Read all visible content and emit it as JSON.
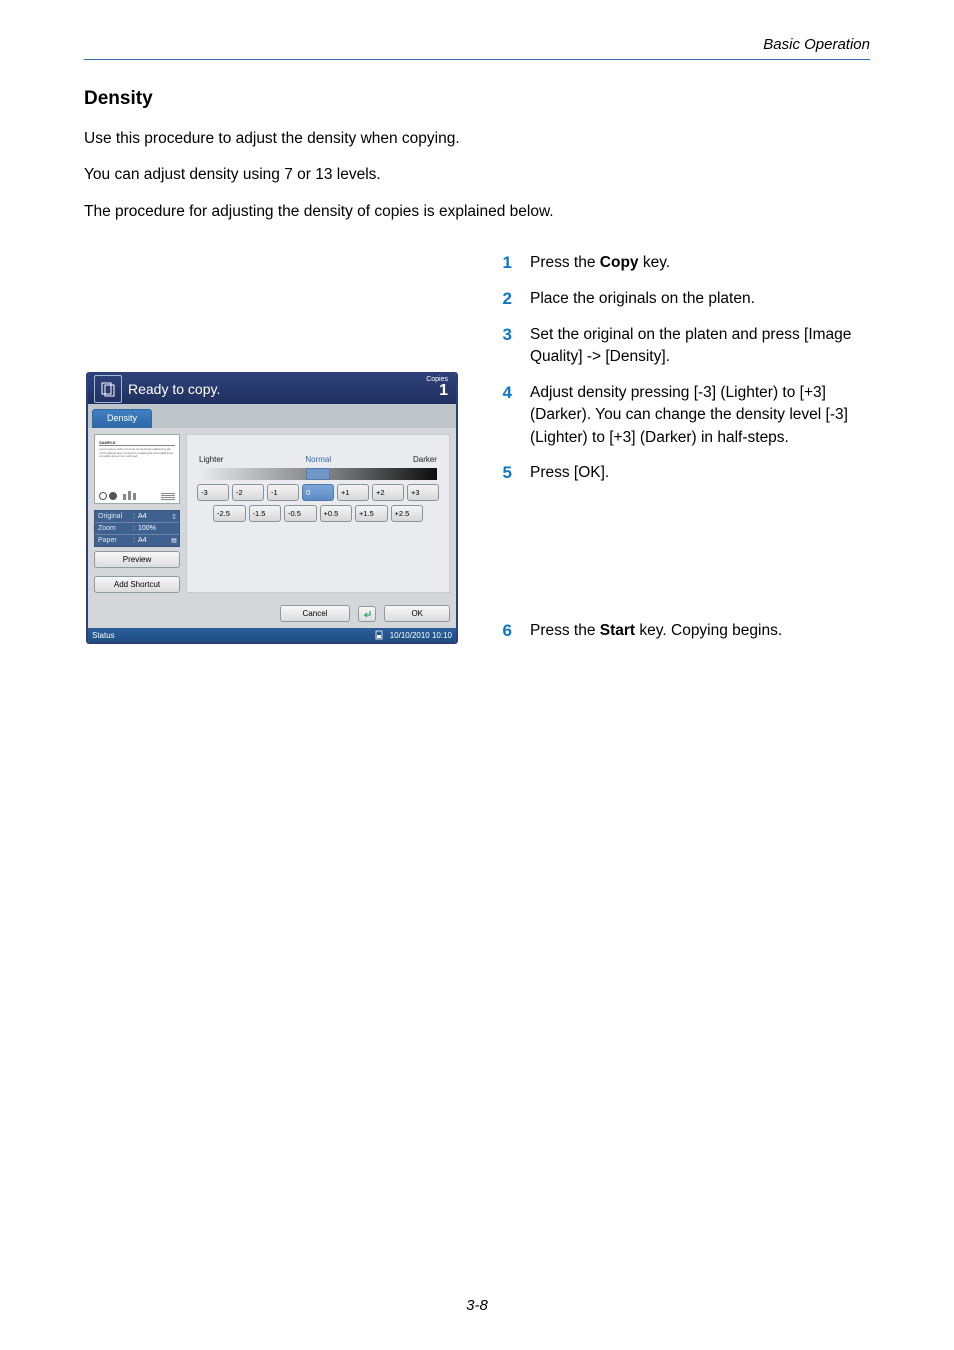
{
  "header": {
    "running_head": "Basic Operation"
  },
  "section": {
    "title": "Density"
  },
  "paragraphs": {
    "p1": "Use this procedure to adjust the density when copying.",
    "p2": "You can adjust density using 7 or 13 levels.",
    "p3": "The procedure for adjusting the density of copies is explained below."
  },
  "steps": {
    "s1": {
      "n": "1",
      "t": "Press the Copy key."
    },
    "s2": {
      "n": "2",
      "t": "Place the originals on the platen."
    },
    "s3": {
      "n": "3",
      "t": "Set the original on the platen and press [Image Quality] -> [Density]."
    },
    "s4": {
      "n": "4",
      "t": "Adjust density pressing [-3] (Lighter) to [+3] (Darker). You can change the density level [-3] (Lighter) to [+3] (Darker) in half-steps."
    },
    "s5": {
      "n": "5",
      "t": "Press [OK]."
    },
    "s6": {
      "n": "6",
      "t": "Press the Start key. Copying begins."
    }
  },
  "shot": {
    "title": "Ready to copy.",
    "copies_label": "Copies",
    "copies_count": "1",
    "tab": "Density",
    "info": {
      "original_k": "Original",
      "original_v": "A4",
      "zoom_k": "Zoom",
      "zoom_v": "100%",
      "paper_k": "Paper",
      "paper_v": "A4"
    },
    "preview_btn": "Preview",
    "add_shortcut": "Add Shortcut",
    "scale": {
      "lighter": "Lighter",
      "normal": "Normal",
      "darker": "Darker"
    },
    "int_steps": {
      "m3": "-3",
      "m2": "-2",
      "m1": "-1",
      "z": "0",
      "p1": "+1",
      "p2": "+2",
      "p3": "+3"
    },
    "half_steps": {
      "m25": "-2.5",
      "m15": "-1.5",
      "m05": "-0.5",
      "p05": "+0.5",
      "p15": "+1.5",
      "p25": "+2.5"
    },
    "cancel": "Cancel",
    "ok": "OK",
    "status": "Status",
    "datetime": "10/10/2010 10:10"
  },
  "pageno": "3-8"
}
